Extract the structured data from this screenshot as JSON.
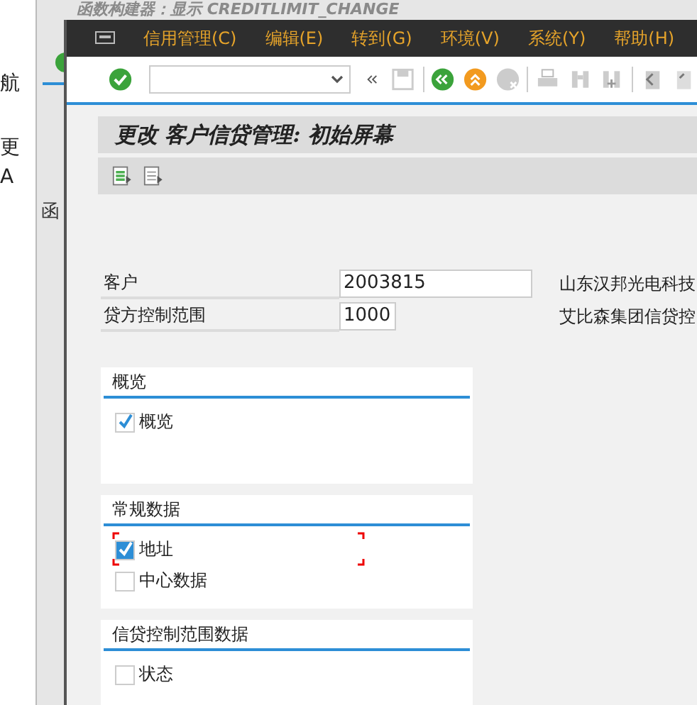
{
  "background_window": {
    "title": "函数构建器：显示 CREDITLIMIT_CHANGE",
    "side_texts": [
      "航",
      "更",
      "A"
    ],
    "tab_text": "函"
  },
  "window": {
    "menu": [
      "信用管理(C)",
      "编辑(E)",
      "转到(G)",
      "环境(V)",
      "系统(Y)",
      "帮助(H)"
    ],
    "title": "更改 客户信贷管理: 初始屏幕"
  },
  "fields": [
    {
      "label": "客户",
      "value": "2003815",
      "description": "山东汉邦光电科技"
    },
    {
      "label": "贷方控制范围",
      "value": "1000",
      "description": "艾比森集团信贷控"
    }
  ],
  "groups": [
    {
      "title": "概览",
      "items": [
        {
          "label": "概览",
          "checked": true,
          "focused": false
        }
      ]
    },
    {
      "title": "常规数据",
      "items": [
        {
          "label": "地址",
          "checked": true,
          "focused": true
        },
        {
          "label": "中心数据",
          "checked": false,
          "focused": false
        }
      ]
    },
    {
      "title": "信贷控制范围数据",
      "items": [
        {
          "label": "状态",
          "checked": false,
          "focused": false
        }
      ]
    }
  ]
}
